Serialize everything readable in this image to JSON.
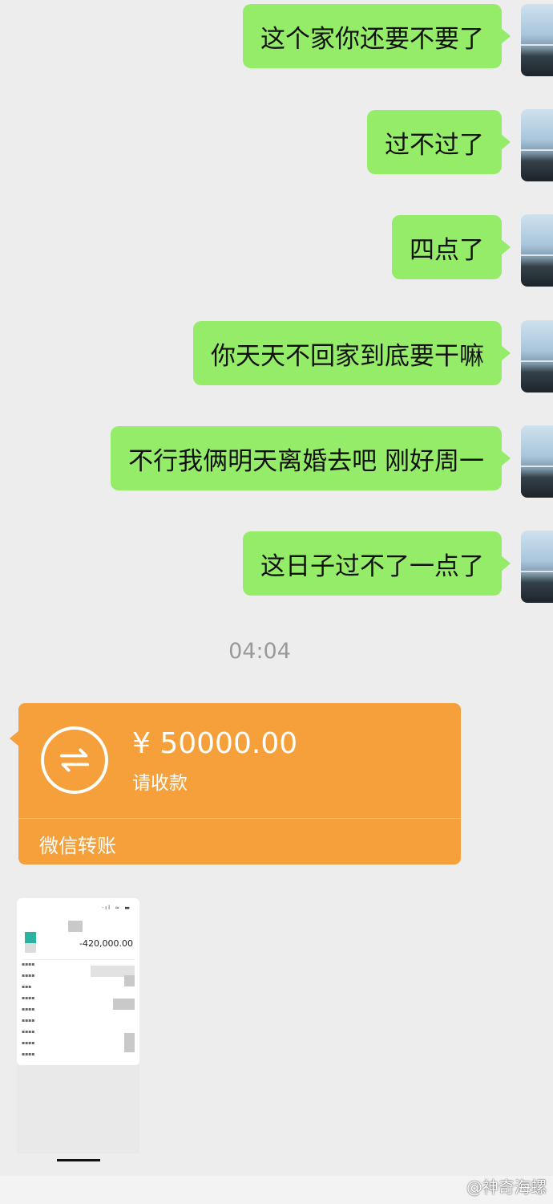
{
  "messages": [
    {
      "text": "这个家你还要不要了"
    },
    {
      "text": "过不过了"
    },
    {
      "text": "四点了"
    },
    {
      "text": "你天天不回家到底要干嘛"
    },
    {
      "text": "不行我俩明天离婚去吧 刚好周一"
    },
    {
      "text": "这日子过不了一点了"
    }
  ],
  "timestamp": "04:04",
  "transfer": {
    "amount": "¥ 50000.00",
    "note": "请收款",
    "label": "微信转账",
    "icon": "transfer-arrows-icon",
    "color": "#f5a03b"
  },
  "screenshot": {
    "amount": "-420,000.00"
  },
  "watermark": "@神奇海螺",
  "colors": {
    "bubble": "#95ec69",
    "background": "#ededed"
  }
}
